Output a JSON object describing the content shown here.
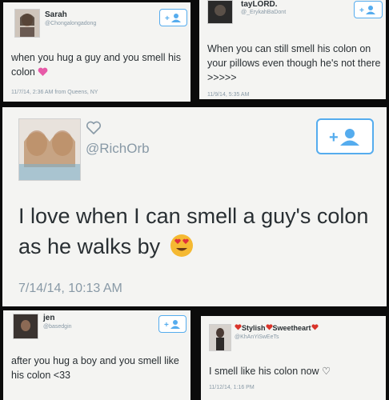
{
  "tweets": [
    {
      "name": "Sarah",
      "handle": "@Chongalongadong",
      "text": "when you hug a guy and you smell his colon",
      "meta": "11/7/14, 2:36 AM from Queens, NY",
      "emoji": "pink-heart"
    },
    {
      "name": "tayLORD.",
      "handle": "@_ErykahBaDont",
      "text": "When you can still smell his colon on your pillows even though he's not there >>>>>",
      "meta": "11/9/14, 5:35 AM"
    },
    {
      "name": "",
      "handle": "@RichOrb",
      "text": "I love when I can smell a guy's colon as he walks by",
      "meta": "7/14/14, 10:13 AM",
      "emoji": "heart-eyes"
    },
    {
      "name": "jen",
      "handle": "@basedgin",
      "text": "after you hug a boy and you smell like his colon <33",
      "meta": ""
    },
    {
      "name_parts": [
        "Stylish",
        "Sweetheart"
      ],
      "handle": "@KhAnYiSwEeTs",
      "text": "I smell like his colon now ♡",
      "meta": "11/12/14, 1:16 PM"
    }
  ],
  "colors": {
    "twitter_blue": "#55acee",
    "text": "#292f33",
    "muted": "#8899a6",
    "pink_heart": "#e75aa8",
    "red_heart": "#d9342b",
    "emoji_yellow": "#f5b932"
  },
  "icons": [
    "follow-button-icon",
    "heart-outline-icon",
    "pink-heart-emoji",
    "heart-eyes-emoji",
    "red-heart-icon"
  ]
}
